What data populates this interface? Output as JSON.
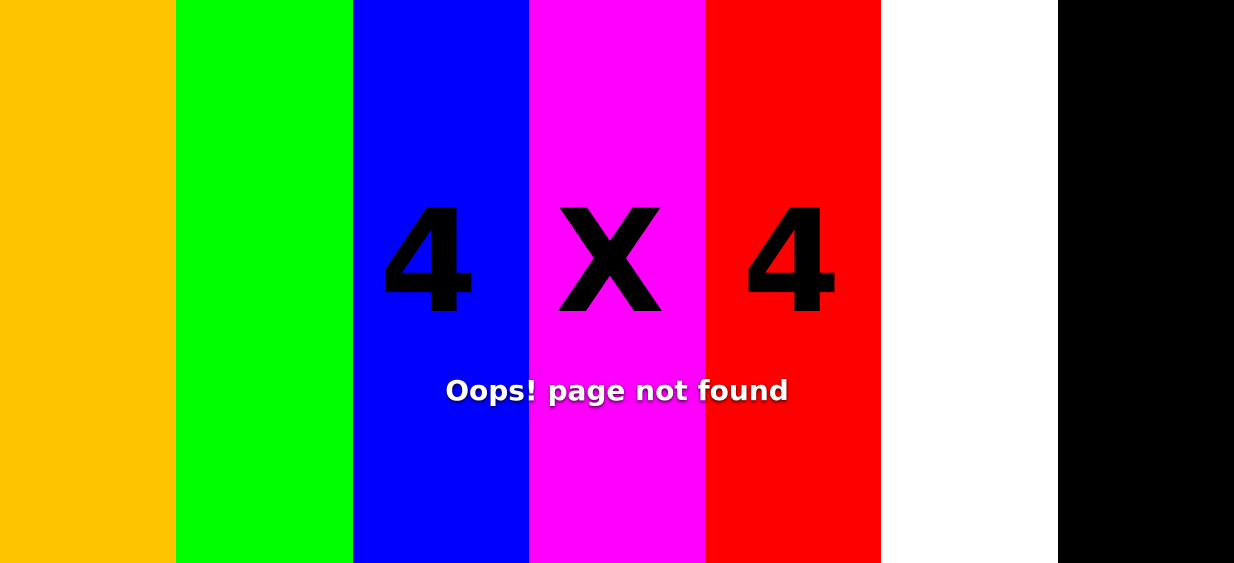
{
  "error": {
    "code": "4 X 4",
    "message": "Oops! page not found"
  },
  "colors": {
    "bars": [
      "#ffc400",
      "#00ff00",
      "#0000ff",
      "#ff00ff",
      "#ff0000",
      "#ffffff",
      "#000000"
    ],
    "code_text": "#000000",
    "message_text": "#ffffff"
  }
}
